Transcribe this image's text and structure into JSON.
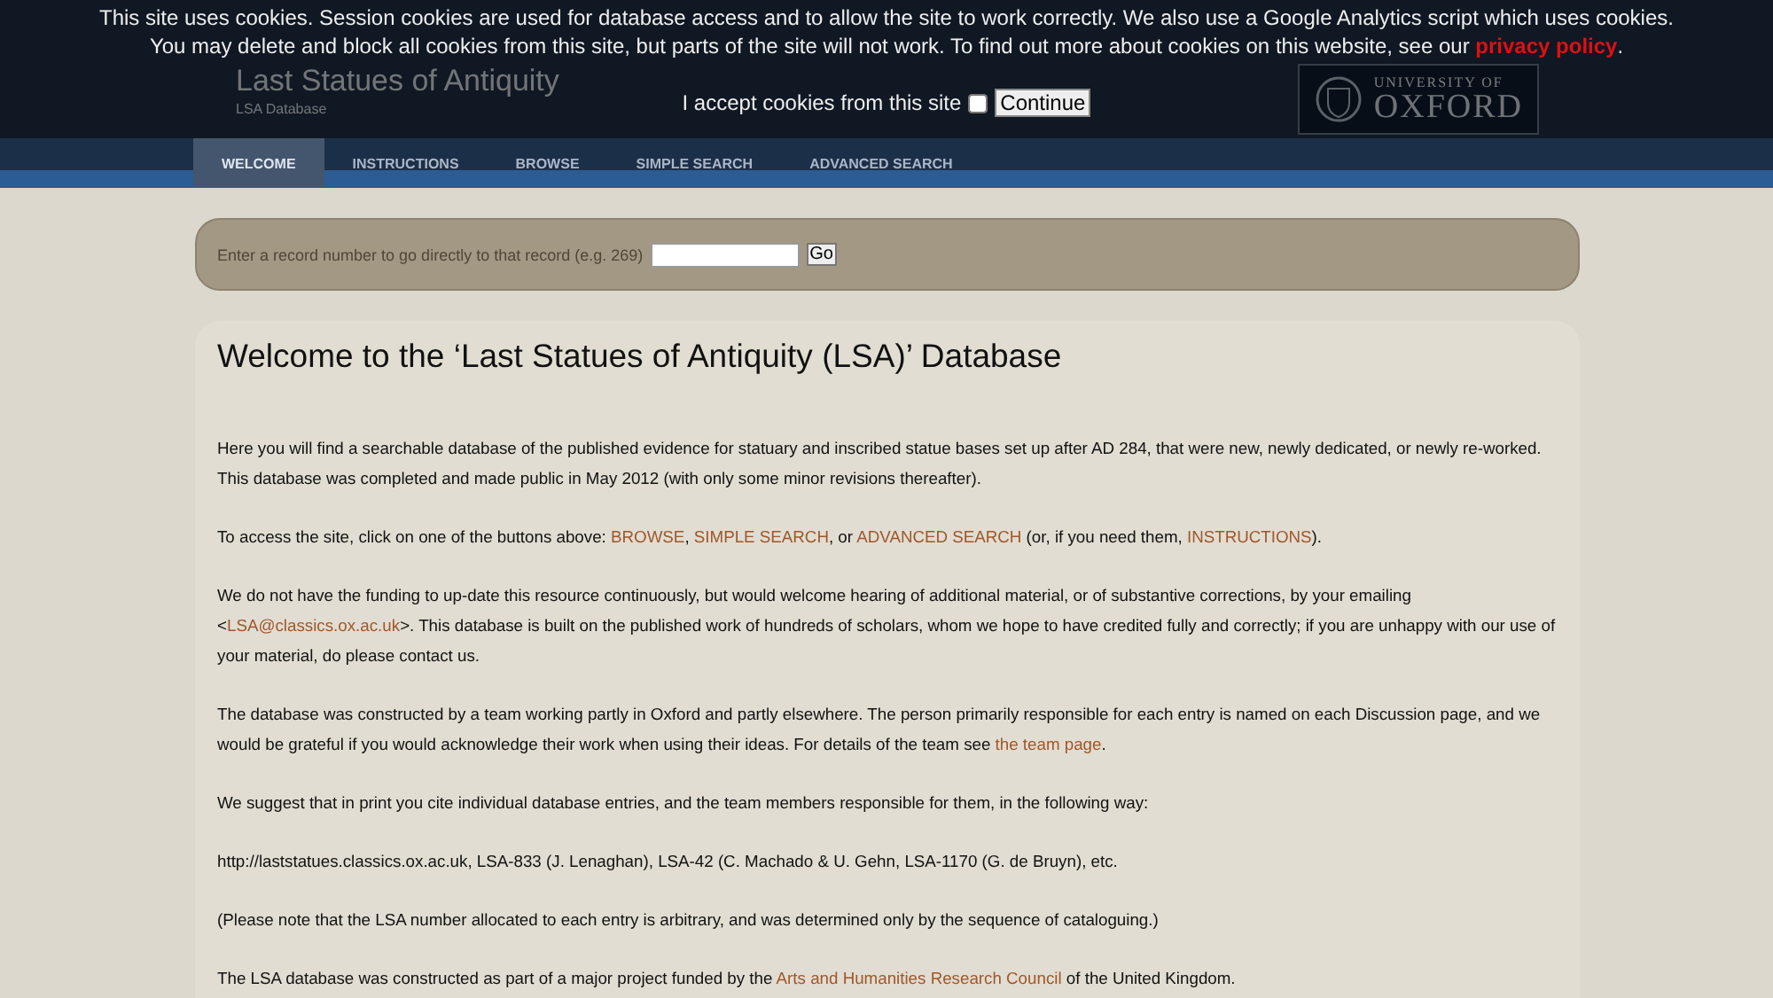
{
  "cookie_banner": {
    "message": [
      {
        "text": "This site uses cookies. Session cookies are used for database access and to allow the site to work correctly. We also use a Google Analytics script which uses cookies. You may delete and block all cookies from this site, but parts of the site will not work. To find out more about cookies on this website, see our "
      },
      {
        "kind": "link",
        "text": "privacy policy"
      },
      {
        "text": "."
      }
    ],
    "accept_label": "I accept cookies from this site",
    "checked": false,
    "button": "Continue"
  },
  "header": {
    "title": "Last Statues of Antiquity",
    "subtitle": "LSA Database",
    "logo_line_1": "UNIVERSITY OF",
    "logo_line_2": "OXFORD"
  },
  "nav": [
    {
      "label": "WELCOME",
      "selected": true
    },
    {
      "label": "INSTRUCTIONS",
      "selected": false
    },
    {
      "label": "BROWSE",
      "selected": false
    },
    {
      "label": "SIMPLE SEARCH",
      "selected": false
    },
    {
      "label": "ADVANCED SEARCH",
      "selected": false
    }
  ],
  "record_bar": {
    "label": "Enter a record number to go directly to that record (e.g. 269)",
    "button": "Go"
  },
  "content": {
    "heading": "Welcome to the ‘Last Statues of Antiquity (LSA)’ Database",
    "paragraphs": [
      [
        {
          "text": "Here you will find a searchable database of the published evidence for statuary and inscribed statue bases set up after AD 284, that were new, newly dedicated, or newly re-worked. This database was completed and made public in May 2012 (with only some minor revisions thereafter)."
        }
      ],
      [
        {
          "text": "To access the site, click on one of the buttons above: "
        },
        {
          "kind": "link",
          "text": "BROWSE"
        },
        {
          "text": ", "
        },
        {
          "kind": "link",
          "text": "SIMPLE SEARCH"
        },
        {
          "text": ", or "
        },
        {
          "kind": "link",
          "text": "ADVANCED SEARCH"
        },
        {
          "text": " (or, if you need them, "
        },
        {
          "kind": "link",
          "text": "INSTRUCTIONS"
        },
        {
          "text": ")."
        }
      ],
      [
        {
          "text": "We do not have the funding to up-date this resource continuously, but would welcome hearing of additional material, or of substantive corrections, by your emailing <"
        },
        {
          "kind": "link",
          "text": "LSA@classics.ox.ac.uk"
        },
        {
          "text": ">. This database is built on the published work of hundreds of scholars, whom we hope to have credited fully and correctly; if you are unhappy with our use of your material, do please contact us."
        }
      ],
      [
        {
          "text": "The database was constructed by a team working partly in Oxford and partly elsewhere. The person primarily responsible for each entry is named on each Discussion page, and we would be grateful if you would acknowledge their work when using their ideas. For details of the team see "
        },
        {
          "kind": "link",
          "text": "the team page"
        },
        {
          "text": "."
        }
      ],
      [
        {
          "text": "We suggest that in print you cite individual database entries, and the team members responsible for them, in the following way:"
        }
      ],
      [
        {
          "text": "http://laststatues.classics.ox.ac.uk, LSA-833 (J. Lenaghan), LSA-42 (C. Machado & U. Gehn, LSA-1170 (G. de Bruyn), etc."
        }
      ],
      [
        {
          "text": "(Please note that the LSA number allocated to each entry is arbitrary, and was determined only by the sequence of cataloguing.)"
        }
      ],
      [
        {
          "text": "The LSA database was constructed as part of a major project funded by the "
        },
        {
          "kind": "link",
          "text": "Arts and Humanities Research Council"
        },
        {
          "text": " of the United Kingdom."
        }
      ]
    ]
  }
}
